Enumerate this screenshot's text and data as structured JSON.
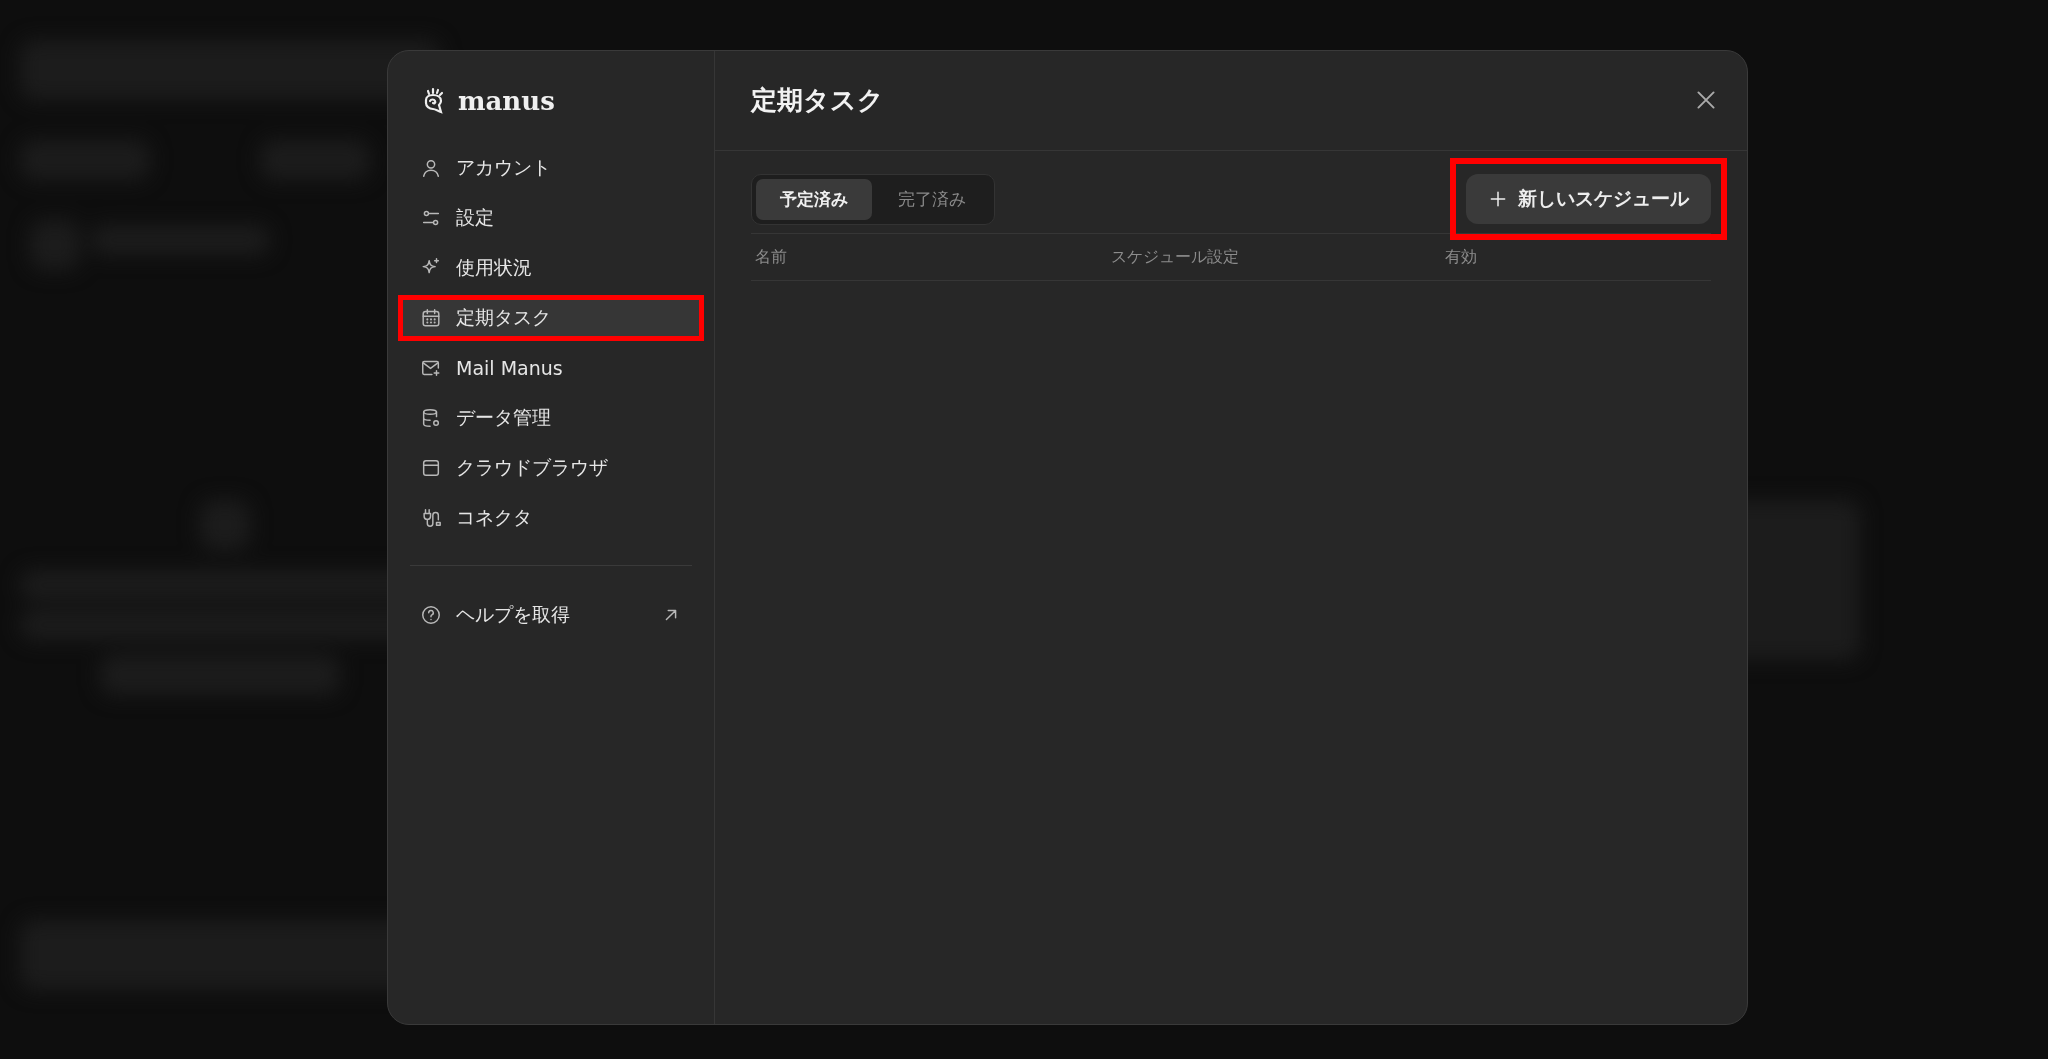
{
  "dialog": {
    "logo_text": "manus",
    "title": "定期タスク"
  },
  "nav": [
    {
      "label": "アカウント",
      "selected": false,
      "highlighted": false
    },
    {
      "label": "設定",
      "selected": false,
      "highlighted": false
    },
    {
      "label": "使用状況",
      "selected": false,
      "highlighted": false
    },
    {
      "label": "定期タスク",
      "selected": true,
      "highlighted": true
    },
    {
      "label": "Mail Manus",
      "selected": false,
      "highlighted": false
    },
    {
      "label": "データ管理",
      "selected": false,
      "highlighted": false
    },
    {
      "label": "クラウドブラウザ",
      "selected": false,
      "highlighted": false
    },
    {
      "label": "コネクタ",
      "selected": false,
      "highlighted": false
    }
  ],
  "help": {
    "label": "ヘルプを取得"
  },
  "tabs": [
    {
      "label": "予定済み",
      "selected": true
    },
    {
      "label": "完了済み",
      "selected": false
    }
  ],
  "new_button": {
    "label": "新しいスケジュール",
    "highlighted": true
  },
  "table": {
    "columns": [
      "名前",
      "スケジュール設定",
      "有効"
    ]
  }
}
